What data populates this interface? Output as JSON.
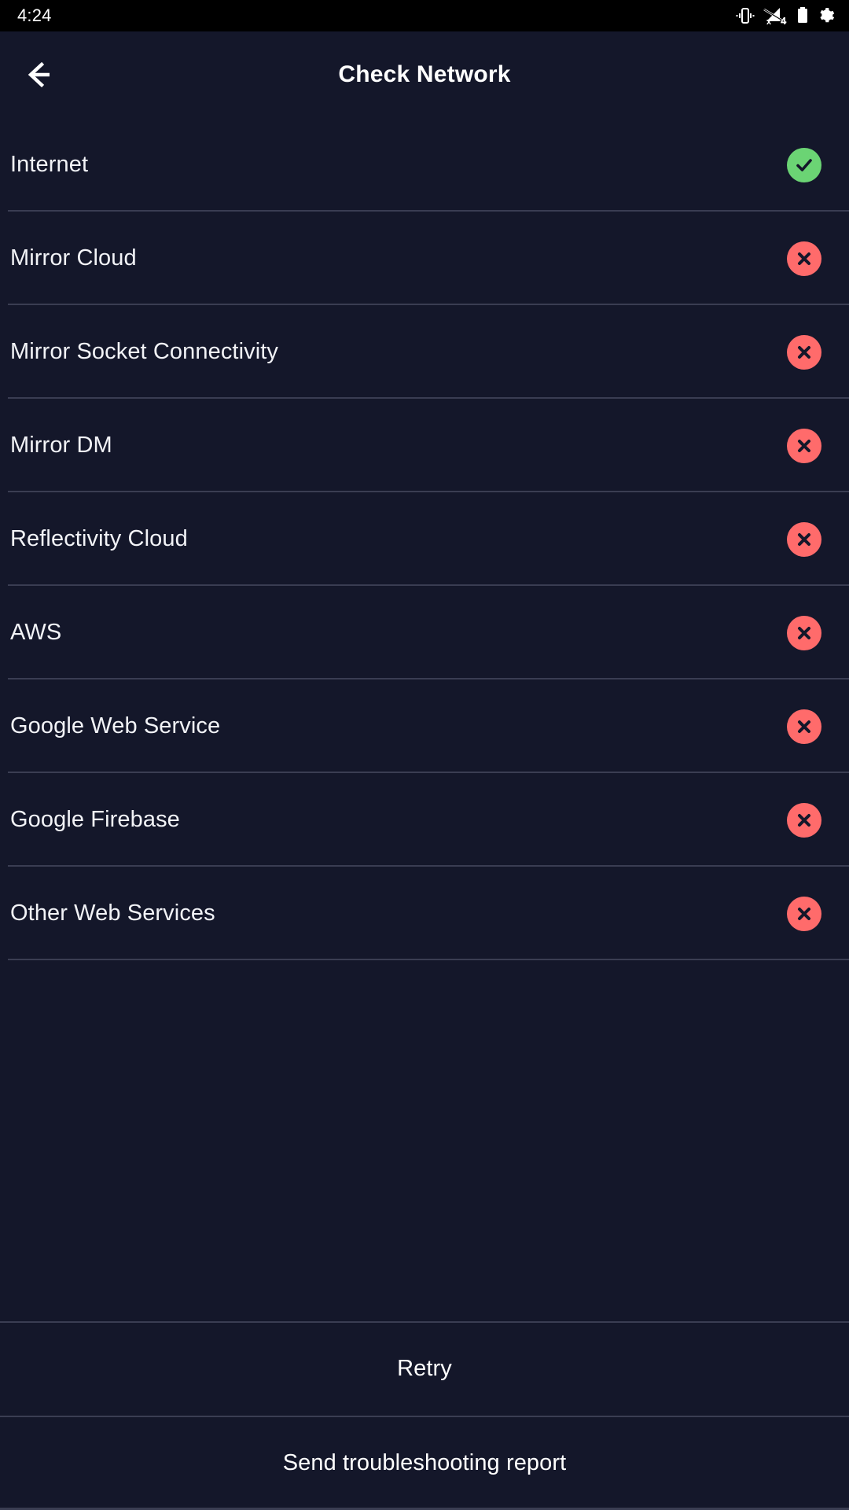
{
  "statusbar": {
    "time": "4:24",
    "icons": [
      {
        "name": "vibrate-icon"
      },
      {
        "name": "mobile-data-off-4g-icon",
        "badge": "4"
      },
      {
        "name": "battery-icon"
      },
      {
        "name": "gear-icon"
      }
    ]
  },
  "appbar": {
    "back_label": "Back",
    "back_icon": "arrow-left-icon",
    "title": "Check Network"
  },
  "colors": {
    "background": "#14172a",
    "statusbar_background": "#000000",
    "divider": "#3a3d52",
    "text_primary": "#f2f3f7",
    "success": "#6bd474",
    "error": "#ff6b6b"
  },
  "checks": [
    {
      "label": "Internet",
      "status": "ok",
      "icon": "check-circle-icon"
    },
    {
      "label": "Mirror Cloud",
      "status": "error",
      "icon": "x-circle-icon"
    },
    {
      "label": "Mirror Socket Connectivity",
      "status": "error",
      "icon": "x-circle-icon"
    },
    {
      "label": "Mirror DM",
      "status": "error",
      "icon": "x-circle-icon"
    },
    {
      "label": "Reflectivity Cloud",
      "status": "error",
      "icon": "x-circle-icon"
    },
    {
      "label": "AWS",
      "status": "error",
      "icon": "x-circle-icon"
    },
    {
      "label": "Google Web Service",
      "status": "error",
      "icon": "x-circle-icon"
    },
    {
      "label": "Google Firebase",
      "status": "error",
      "icon": "x-circle-icon"
    },
    {
      "label": "Other Web Services",
      "status": "error",
      "icon": "x-circle-icon"
    }
  ],
  "actions": [
    {
      "label": "Retry",
      "name": "retry-button"
    },
    {
      "label": "Send troubleshooting report",
      "name": "send-troubleshooting-report-button"
    }
  ]
}
